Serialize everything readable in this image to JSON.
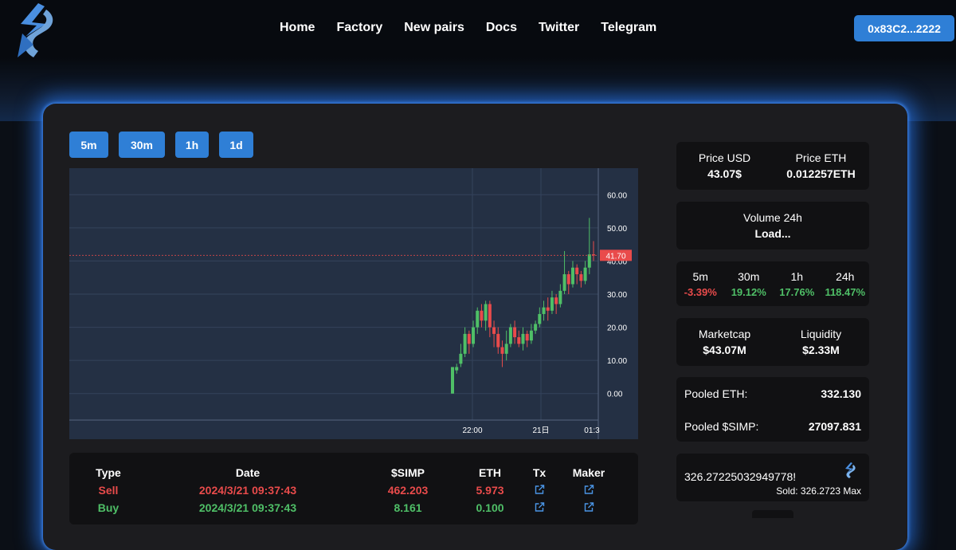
{
  "nav": {
    "items": [
      "Home",
      "Factory",
      "New pairs",
      "Docs",
      "Twitter",
      "Telegram"
    ],
    "wallet": "0x83C2...2222"
  },
  "timeframes": [
    "5m",
    "30m",
    "1h",
    "1d"
  ],
  "chart_data": {
    "type": "candlestick",
    "y_ticks": [
      "60.00",
      "50.00",
      "40.00",
      "30.00",
      "20.00",
      "10.00",
      "0.00"
    ],
    "ylim": [
      -8,
      68
    ],
    "x_ticks": [
      "22:00",
      "21日",
      "01:3"
    ],
    "last_price_label": "41.70",
    "last_price": 41.7,
    "candles": [
      [
        0,
        8,
        0,
        7
      ],
      [
        7,
        8,
        6,
        9
      ],
      [
        9,
        12,
        8,
        15
      ],
      [
        12,
        18,
        11,
        20
      ],
      [
        18,
        15,
        12,
        19
      ],
      [
        15,
        20,
        14,
        22
      ],
      [
        20,
        25,
        18,
        26
      ],
      [
        25,
        22,
        20,
        27
      ],
      [
        22,
        27,
        19,
        28
      ],
      [
        27,
        20,
        17,
        28
      ],
      [
        20,
        18,
        14,
        22
      ],
      [
        18,
        14,
        12,
        20
      ],
      [
        14,
        12,
        8,
        16
      ],
      [
        12,
        15,
        10,
        19
      ],
      [
        15,
        20,
        14,
        21
      ],
      [
        20,
        17,
        15,
        22
      ],
      [
        17,
        15,
        14,
        19
      ],
      [
        15,
        18,
        13,
        20
      ],
      [
        18,
        16,
        14,
        19
      ],
      [
        16,
        19,
        15,
        21
      ],
      [
        19,
        21,
        18,
        22
      ],
      [
        21,
        24,
        20,
        26
      ],
      [
        24,
        26,
        22,
        28
      ],
      [
        26,
        25,
        22,
        29
      ],
      [
        25,
        29,
        24,
        31
      ],
      [
        29,
        27,
        24,
        30
      ],
      [
        27,
        31,
        26,
        33
      ],
      [
        31,
        36,
        30,
        43
      ],
      [
        36,
        33,
        30,
        37
      ],
      [
        33,
        38,
        32,
        40
      ],
      [
        38,
        36,
        33,
        39
      ],
      [
        36,
        34,
        32,
        37
      ],
      [
        34,
        38,
        33,
        40
      ],
      [
        38,
        42,
        36,
        53
      ],
      [
        42,
        41.7,
        40,
        46
      ]
    ]
  },
  "stats": {
    "price_usd_label": "Price USD",
    "price_usd": "43.07$",
    "price_eth_label": "Price ETH",
    "price_eth": "0.012257ETH",
    "volume_label": "Volume 24h",
    "volume_value": "Load...",
    "changes": [
      {
        "label": "5m",
        "value": "-3.39%",
        "color": "#e94b4b"
      },
      {
        "label": "30m",
        "value": "19.12%",
        "color": "#4fbf67"
      },
      {
        "label": "1h",
        "value": "17.76%",
        "color": "#4fbf67"
      },
      {
        "label": "24h",
        "value": "118.47%",
        "color": "#4fbf67"
      }
    ],
    "marketcap_label": "Marketcap",
    "marketcap": "$43.07M",
    "liquidity_label": "Liquidity",
    "liquidity": "$2.33M",
    "pooled_eth_label": "Pooled ETH:",
    "pooled_eth": "332.130",
    "pooled_simp_label": "Pooled $SIMP:",
    "pooled_simp": "27097.831"
  },
  "swap": {
    "amount": "326.27225032949778!",
    "sold_text": "Sold: 326.2723 Max"
  },
  "trades": {
    "headers": [
      "Type",
      "Date",
      "$SIMP",
      "ETH",
      "Tx",
      "Maker"
    ],
    "rows": [
      {
        "type": "Sell",
        "date": "2024/3/21 09:37:43",
        "simp": "462.203",
        "eth": "5.973",
        "color": "#e94b4b"
      },
      {
        "type": "Buy",
        "date": "2024/3/21 09:37:43",
        "simp": "8.161",
        "eth": "0.100",
        "color": "#4fbf67"
      }
    ]
  },
  "colors": {
    "accent": "#2f7fd6",
    "up": "#4fbf67",
    "down": "#e94b4b",
    "chart_bg": "#243044"
  }
}
